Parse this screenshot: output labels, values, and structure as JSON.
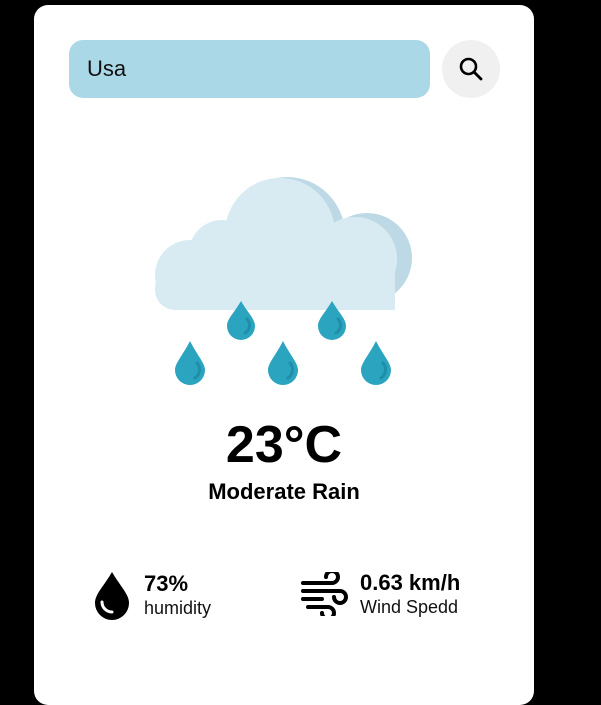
{
  "search": {
    "value": "Usa",
    "button_icon": "search-icon"
  },
  "weather": {
    "icon": "rain-cloud-icon",
    "temperature": "23°C",
    "condition": "Moderate Rain"
  },
  "details": {
    "humidity": {
      "icon": "water-drop-icon",
      "value": "73%",
      "label": "humidity"
    },
    "wind": {
      "icon": "wind-icon",
      "value": "0.63 km/h",
      "label": "Wind Spedd"
    }
  },
  "colors": {
    "background": "#000000",
    "card": "#ffffff",
    "search_field": "#abd8e6",
    "search_button": "#f0f0f0",
    "cloud": "#d8ebf2",
    "cloud_shadow": "#bdd9e6",
    "raindrop": "#2aa4bf"
  }
}
